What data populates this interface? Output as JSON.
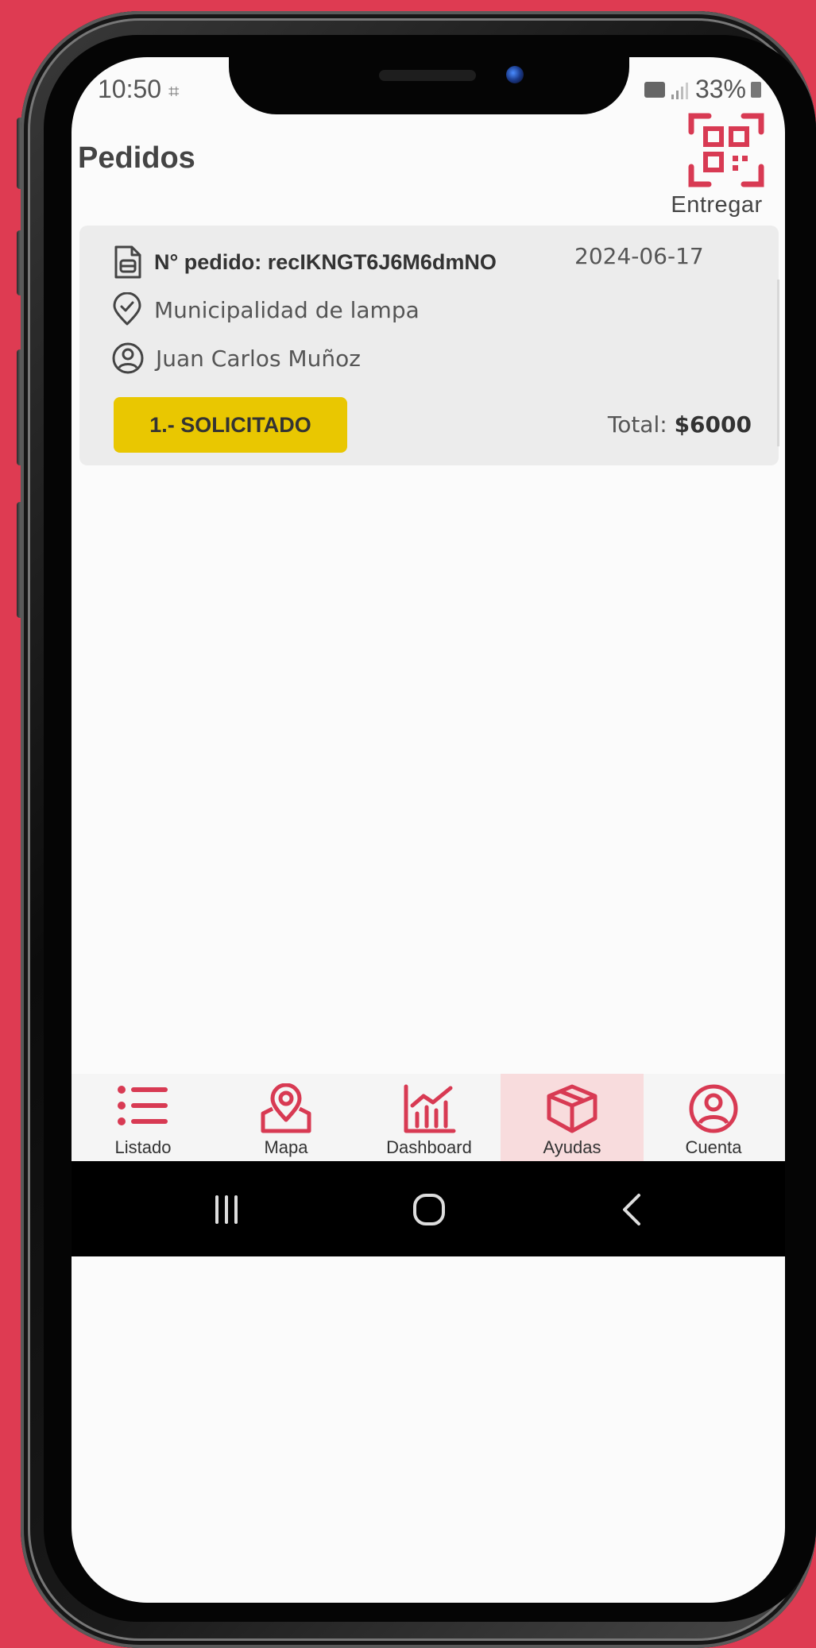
{
  "status_bar": {
    "time": "10:50",
    "battery": "33%"
  },
  "header": {
    "title": "Pedidos",
    "deliver_label": "Entregar"
  },
  "order": {
    "id_label": "N° pedido: recIKNGT6J6M6dmNO",
    "date": "2024-06-17",
    "location": "Municipalidad de lampa",
    "person": "Juan Carlos Muñoz",
    "status": "1.- SOLICITADO",
    "total_label": "Total: ",
    "total_value": "$6000"
  },
  "tabs": [
    {
      "label": "Listado",
      "icon": "list-icon"
    },
    {
      "label": "Mapa",
      "icon": "map-pin-icon"
    },
    {
      "label": "Dashboard",
      "icon": "chart-icon"
    },
    {
      "label": "Ayudas",
      "icon": "box-icon",
      "active": true
    },
    {
      "label": "Cuenta",
      "icon": "user-circle-icon"
    }
  ],
  "colors": {
    "accent": "#d83a53",
    "status_yellow": "#e9c701",
    "background": "#de3b52"
  }
}
